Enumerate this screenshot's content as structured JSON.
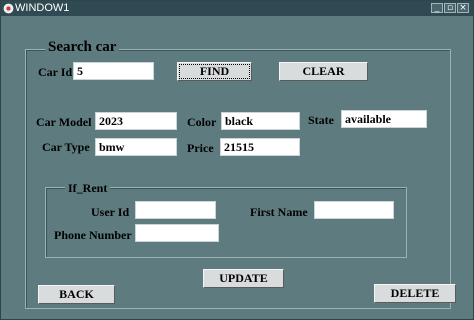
{
  "window": {
    "title": "WINDOW1",
    "icon": "app-icon",
    "controls": [
      "minimize-icon",
      "maximize-icon",
      "close-icon"
    ]
  },
  "search": {
    "legend": "Search car",
    "car_id_label": "Car Id",
    "car_id_value": "5",
    "find_label": "FIND",
    "clear_label": "CLEAR"
  },
  "details": {
    "car_model_label": "Car Model",
    "car_model_value": "2023",
    "color_label": "Color",
    "color_value": "black",
    "state_label": "State",
    "state_value": "available",
    "car_type_label": "Car Type",
    "car_type_value": "bmw",
    "price_label": "Price",
    "price_value": "21515"
  },
  "rent": {
    "legend": "If_Rent",
    "user_id_label": "User Id",
    "user_id_value": "",
    "first_name_label": "First Name",
    "first_name_value": "",
    "phone_label": "Phone Number",
    "phone_value": ""
  },
  "actions": {
    "update_label": "UPDATE",
    "back_label": "BACK",
    "delete_label": "DELETE"
  }
}
